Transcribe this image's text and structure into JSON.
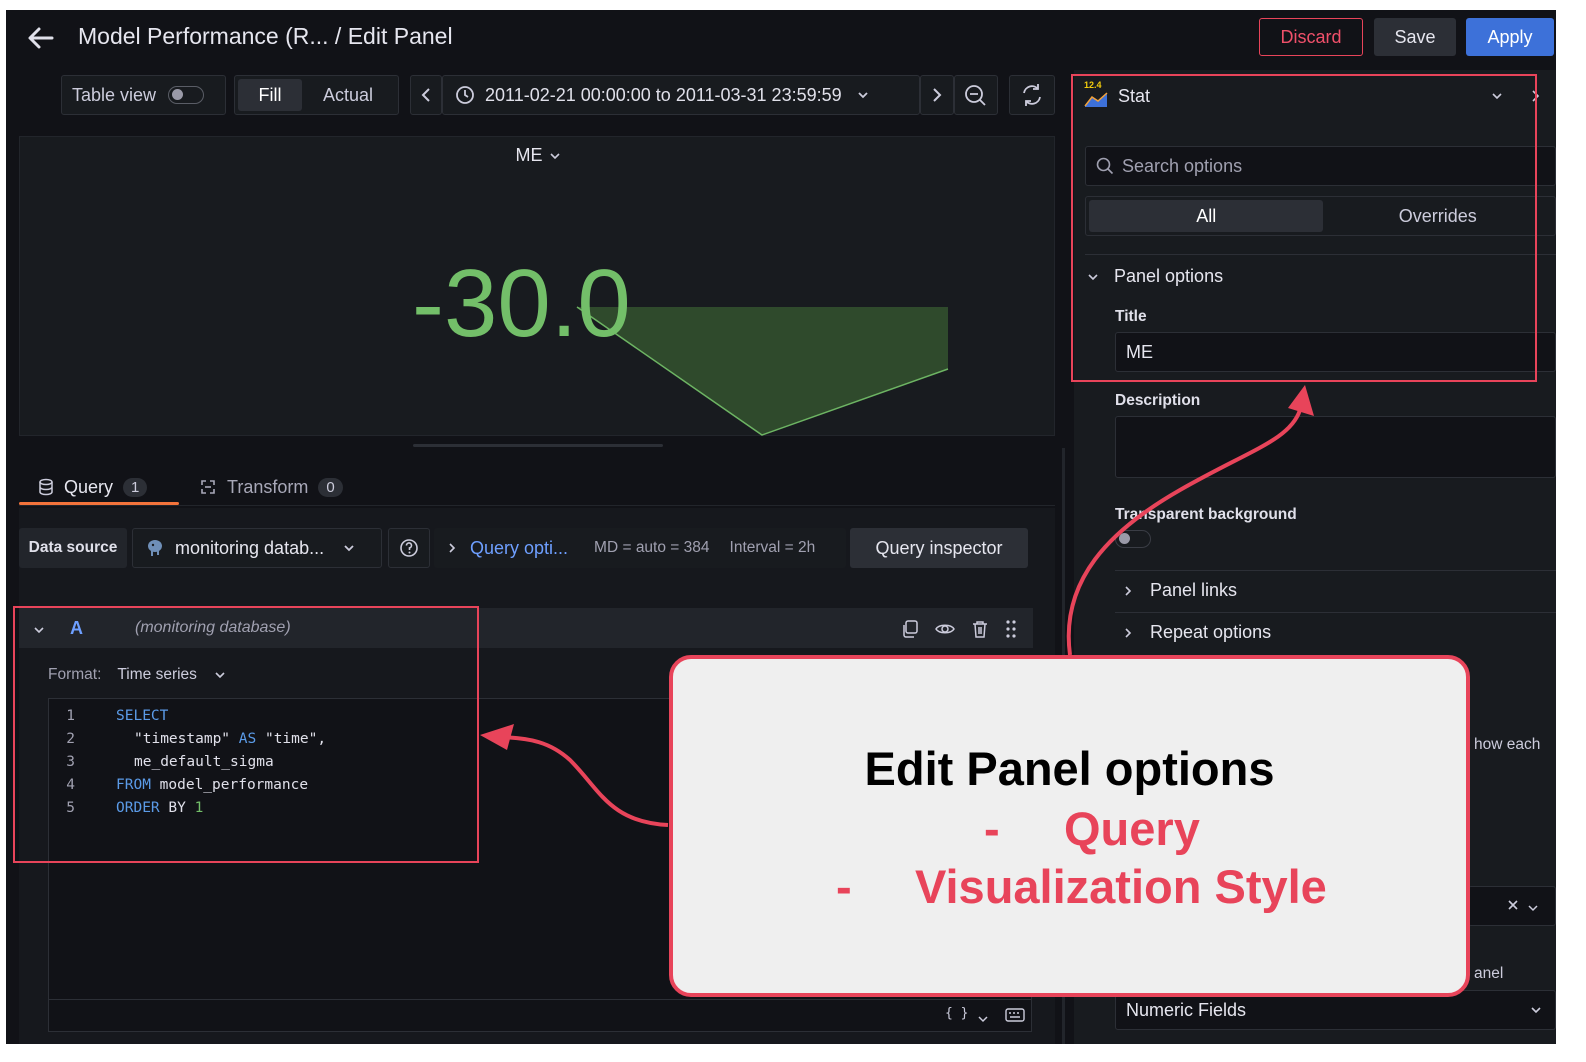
{
  "header": {
    "title": "Model Performance (R... / Edit Panel",
    "discard_label": "Discard",
    "save_label": "Save",
    "apply_label": "Apply"
  },
  "toolbar": {
    "table_view_label": "Table view",
    "fill_label": "Fill",
    "actual_label": "Actual",
    "time_range": "2011-02-21 00:00:00 to 2011-03-31 23:59:59"
  },
  "panel": {
    "title": "ME",
    "stat_value": "-30.0",
    "stat_color": "#73bf69"
  },
  "query_tabs": [
    {
      "label": "Query",
      "count": "1"
    },
    {
      "label": "Transform",
      "count": "0"
    }
  ],
  "datasource": {
    "label": "Data source",
    "value": "monitoring datab...",
    "query_options_label": "Query opti...",
    "md_info": "MD = auto = 384",
    "interval_info": "Interval = 2h",
    "inspector_label": "Query inspector"
  },
  "query_row": {
    "ref": "A",
    "source": "(monitoring database)",
    "format_label": "Format:",
    "format_value": "Time series",
    "bottom_braces": "{ }"
  },
  "code": {
    "line_numbers": [
      "1",
      "2",
      "3",
      "4",
      "5"
    ],
    "l1": "SELECT",
    "l2a": "\"timestamp\"",
    "l2b": "AS",
    "l2c": "\"time\",",
    "l3": "me_default_sigma",
    "l4a": "FROM",
    "l4b": "model_performance",
    "l5a": "ORDER",
    "l5b": "BY",
    "l5c": "1"
  },
  "options_pane": {
    "version_badge": "12.4",
    "viz_name": "Stat",
    "search_placeholder": "Search options",
    "tab_all": "All",
    "tab_overrides": "Overrides",
    "section_panel_options": "Panel options",
    "title_label": "Title",
    "title_value": "ME",
    "description_label": "Description",
    "transparent_label": "Transparent background",
    "panel_links": "Panel links",
    "repeat_options": "Repeat options",
    "partial_show_each": "how each",
    "partial_panel": "anel",
    "numeric_fields": "Numeric Fields"
  },
  "callout": {
    "heading": "Edit Panel options",
    "bullet_dash": "-",
    "item1": "Query",
    "item2": "Visualization Style"
  },
  "colors": {
    "accent_blue": "#3d71d9",
    "annotation_red": "#e8445a",
    "stat_green": "#73bf69",
    "tab_underline": "#f2733b"
  }
}
